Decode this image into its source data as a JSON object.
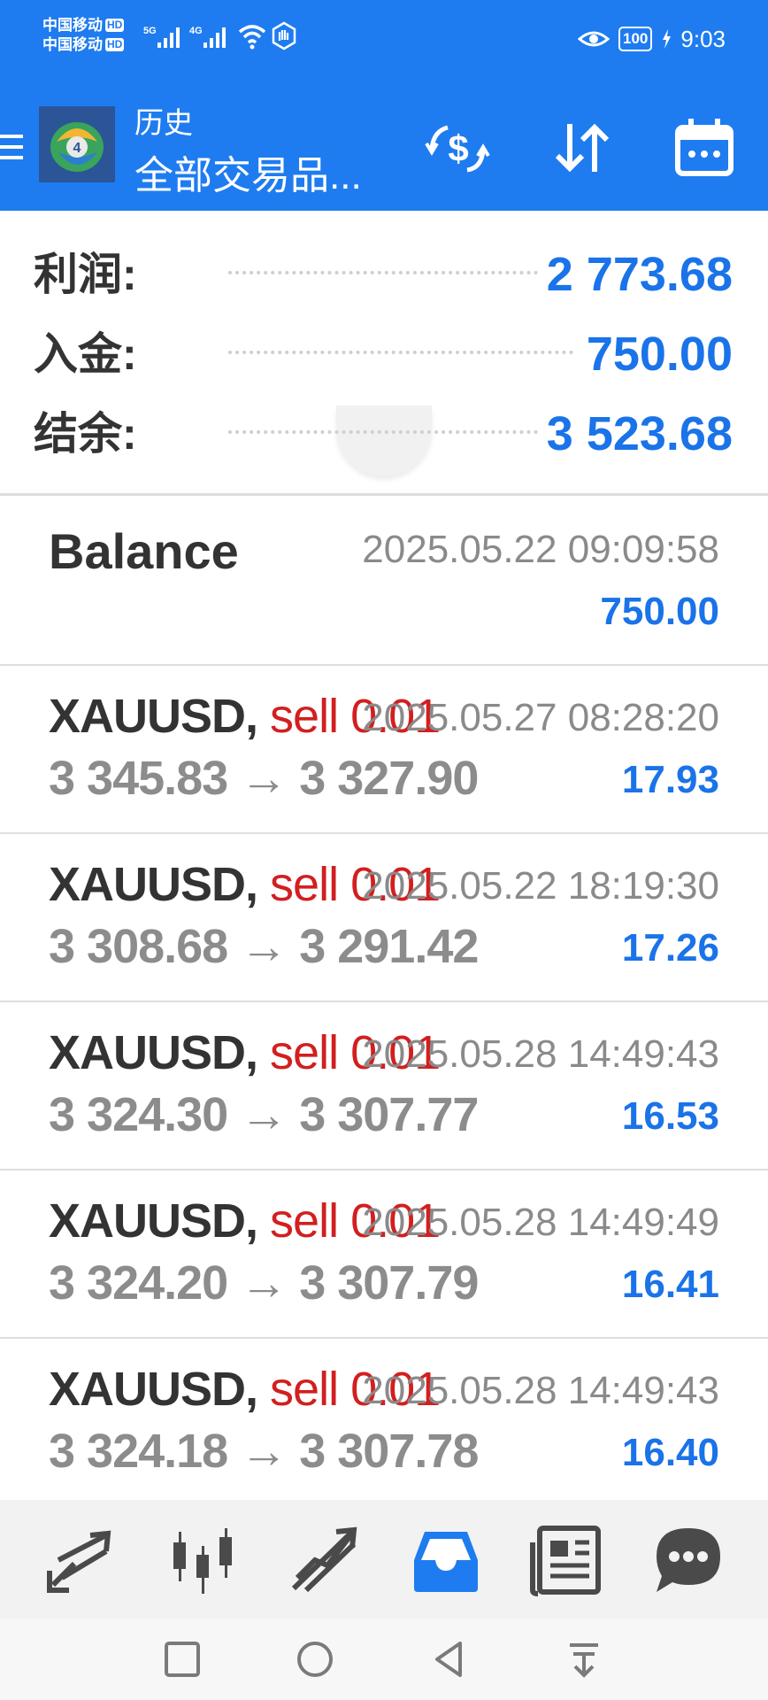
{
  "status_bar": {
    "carrier1": "中国移动",
    "carrier2": "中国移动",
    "hd_badge": "HD",
    "network1": "5G",
    "network2": "4G",
    "battery": "100",
    "time": "9:03"
  },
  "app_bar": {
    "subtitle": "历史",
    "title": "全部交易品...",
    "icons": [
      "menu-icon",
      "mt-logo",
      "currency-swap-icon",
      "sort-icon",
      "calendar-icon"
    ]
  },
  "summary": {
    "profit_label": "利润:",
    "profit_value": "2 773.68",
    "deposit_label": "入金:",
    "deposit_value": "750.00",
    "balance_label": "结余:",
    "balance_value": "3 523.68"
  },
  "balance_entry": {
    "title": "Balance",
    "time": "2025.05.22 09:09:58",
    "amount": "750.00"
  },
  "deals": [
    {
      "symbol": "XAUUSD,",
      "side": "sell 0.01",
      "time": "2025.05.27 08:28:20",
      "prices": "3 345.83 → 3 327.90",
      "profit": "17.93"
    },
    {
      "symbol": "XAUUSD,",
      "side": "sell 0.01",
      "time": "2025.05.22 18:19:30",
      "prices": "3 308.68 → 3 291.42",
      "profit": "17.26"
    },
    {
      "symbol": "XAUUSD,",
      "side": "sell 0.01",
      "time": "2025.05.28 14:49:43",
      "prices": "3 324.30 → 3 307.77",
      "profit": "16.53"
    },
    {
      "symbol": "XAUUSD,",
      "side": "sell 0.01",
      "time": "2025.05.28 14:49:49",
      "prices": "3 324.20 → 3 307.79",
      "profit": "16.41"
    },
    {
      "symbol": "XAUUSD,",
      "side": "sell 0.01",
      "time": "2025.05.28 14:49:43",
      "prices": "3 324.18 → 3 307.78",
      "profit": "16.40"
    }
  ],
  "tabs": [
    "quotes-icon",
    "chart-icon",
    "trade-icon",
    "history-icon",
    "news-icon",
    "chat-icon"
  ],
  "active_tab": "history-icon",
  "nav_buttons": [
    "recents-icon",
    "home-icon",
    "back-icon",
    "notification-pull-icon"
  ],
  "colors": {
    "accent": "#1f7cf0",
    "positive_value": "#1a73e8",
    "sell": "#d21f1f"
  }
}
